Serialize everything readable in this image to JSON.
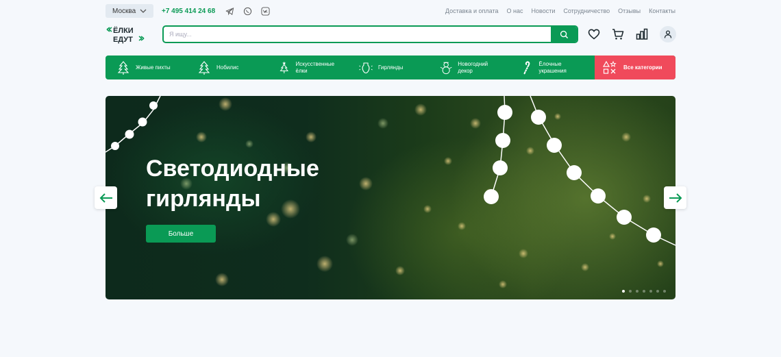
{
  "topbar": {
    "city": "Москва",
    "phone": "+7 495 414 24 68",
    "social": [
      "telegram-icon",
      "whatsapp-icon",
      "vk-icon"
    ],
    "links": [
      "Доставка и оплата",
      "О нас",
      "Новости",
      "Сотрудничество",
      "Отзывы",
      "Контакты"
    ]
  },
  "header": {
    "logo_line1": "ЁЛКИ",
    "logo_line2": "ЕДУТ",
    "search_placeholder": "Я ищу...",
    "icons": [
      "heart-icon",
      "cart-icon",
      "compare-icon",
      "user-icon"
    ]
  },
  "categories": {
    "items": [
      {
        "label": "Живые пихты",
        "icon": "fir-tree-icon"
      },
      {
        "label": "Нобилис",
        "icon": "fir-tree-icon"
      },
      {
        "label": "Искусственные ёлки",
        "icon": "star-tree-icon"
      },
      {
        "label": "Гирлянды",
        "icon": "bulb-icon"
      },
      {
        "label": "Новогодний декор",
        "icon": "snowman-icon"
      },
      {
        "label": "Ёлочные украшения",
        "icon": "candy-cane-icon"
      }
    ],
    "all_label": "Все категории",
    "all_icon": "shapes-icon"
  },
  "hero": {
    "title_line1": "Светодиодные",
    "title_line2": "гирлянды",
    "button": "Больше",
    "slide_count": 7,
    "active_slide": 1
  },
  "colors": {
    "brand_green": "#0a9a55",
    "accent_red": "#f04a5b",
    "background": "#f5f8fc"
  }
}
